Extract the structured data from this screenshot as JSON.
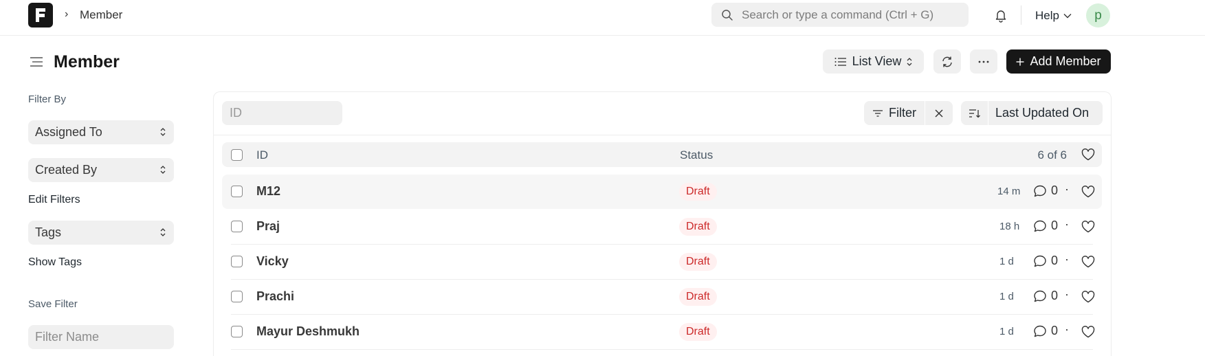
{
  "navbar": {
    "breadcrumb": "Member",
    "search_placeholder": "Search or type a command (Ctrl + G)",
    "help_label": "Help",
    "avatar_initial": "p"
  },
  "page": {
    "title": "Member",
    "list_view_label": "List View",
    "add_button_label": "Add Member",
    "accent_color": "#171717"
  },
  "sidebar": {
    "filter_by_label": "Filter By",
    "assigned_to_label": "Assigned To",
    "created_by_label": "Created By",
    "edit_filters_label": "Edit Filters",
    "tags_label": "Tags",
    "show_tags_label": "Show Tags",
    "save_filter_label": "Save Filter",
    "filter_name_placeholder": "Filter Name"
  },
  "list": {
    "id_placeholder": "ID",
    "filter_label": "Filter",
    "sort_label": "Last Updated On",
    "columns": {
      "id": "ID",
      "status": "Status"
    },
    "count_label": "6 of 6",
    "rows": [
      {
        "name": "M12",
        "status": "Draft",
        "modified": "14 m",
        "comments": "0"
      },
      {
        "name": "Praj",
        "status": "Draft",
        "modified": "18 h",
        "comments": "0"
      },
      {
        "name": "Vicky",
        "status": "Draft",
        "modified": "1 d",
        "comments": "0"
      },
      {
        "name": "Prachi",
        "status": "Draft",
        "modified": "1 d",
        "comments": "0"
      },
      {
        "name": "Mayur Deshmukh",
        "status": "Draft",
        "modified": "1 d",
        "comments": "0"
      }
    ]
  }
}
